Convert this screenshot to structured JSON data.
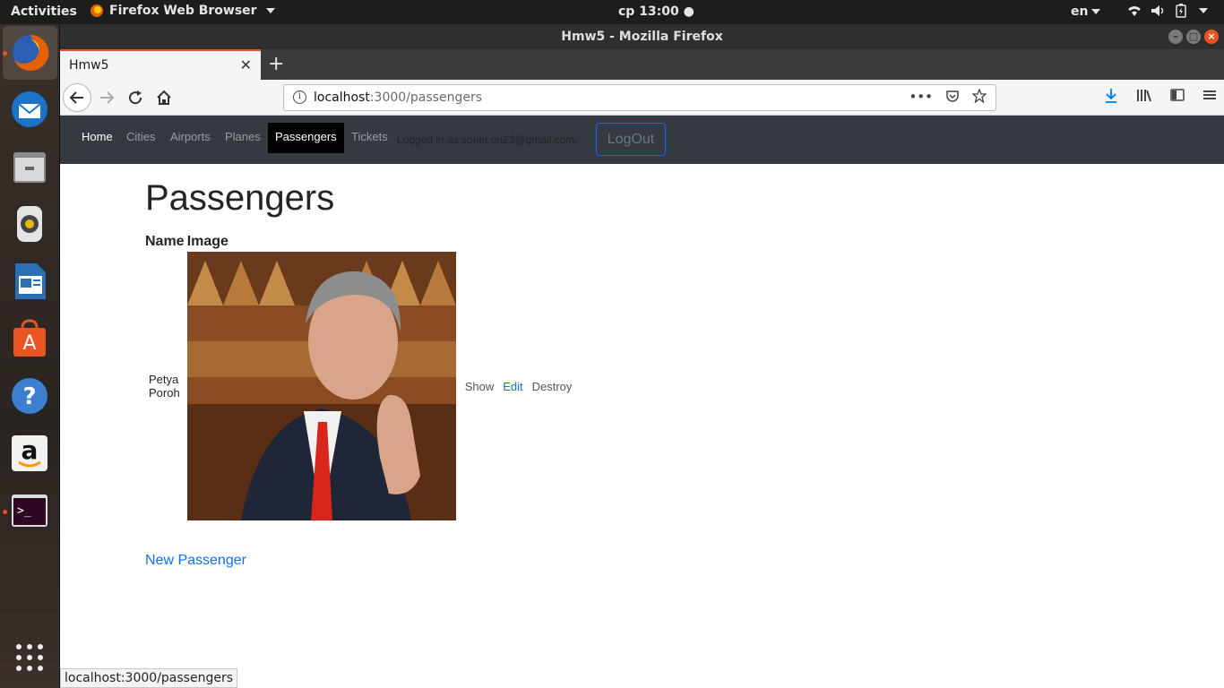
{
  "topbar": {
    "activities": "Activities",
    "app_menu": "Firefox Web Browser",
    "clock": "cp 13:00",
    "language": "en"
  },
  "dock": {
    "items": [
      "firefox-icon",
      "thunderbird-icon",
      "files-icon",
      "rhythmbox-icon",
      "writer-icon",
      "software-icon",
      "help-icon",
      "amazon-icon",
      "terminal-icon"
    ],
    "apps_grid_icon": "apps-grid-icon"
  },
  "window": {
    "title": "Hmw5 - Mozilla Firefox"
  },
  "tabs": [
    {
      "label": "Hmw5"
    }
  ],
  "urlbar": {
    "host": "localhost",
    "path": ":3000/passengers"
  },
  "appnav": {
    "links": [
      "Home",
      "Cities",
      "Airports",
      "Planes",
      "Passengers",
      "Tickets"
    ],
    "logged_in": "Logged in as soner.on23@gmail.com.",
    "logout": "LogOut"
  },
  "page": {
    "title": "Passengers",
    "columns": [
      "Name",
      "Image"
    ],
    "rows": [
      {
        "name": "Petya Poroh",
        "show": "Show",
        "edit": "Edit",
        "destroy": "Destroy"
      }
    ],
    "new_link": "New Passenger"
  },
  "status_url": "localhost:3000/passengers",
  "colors": {
    "accent": "#e95420",
    "nav_bg": "#343a40",
    "link": "#0d6efd"
  }
}
